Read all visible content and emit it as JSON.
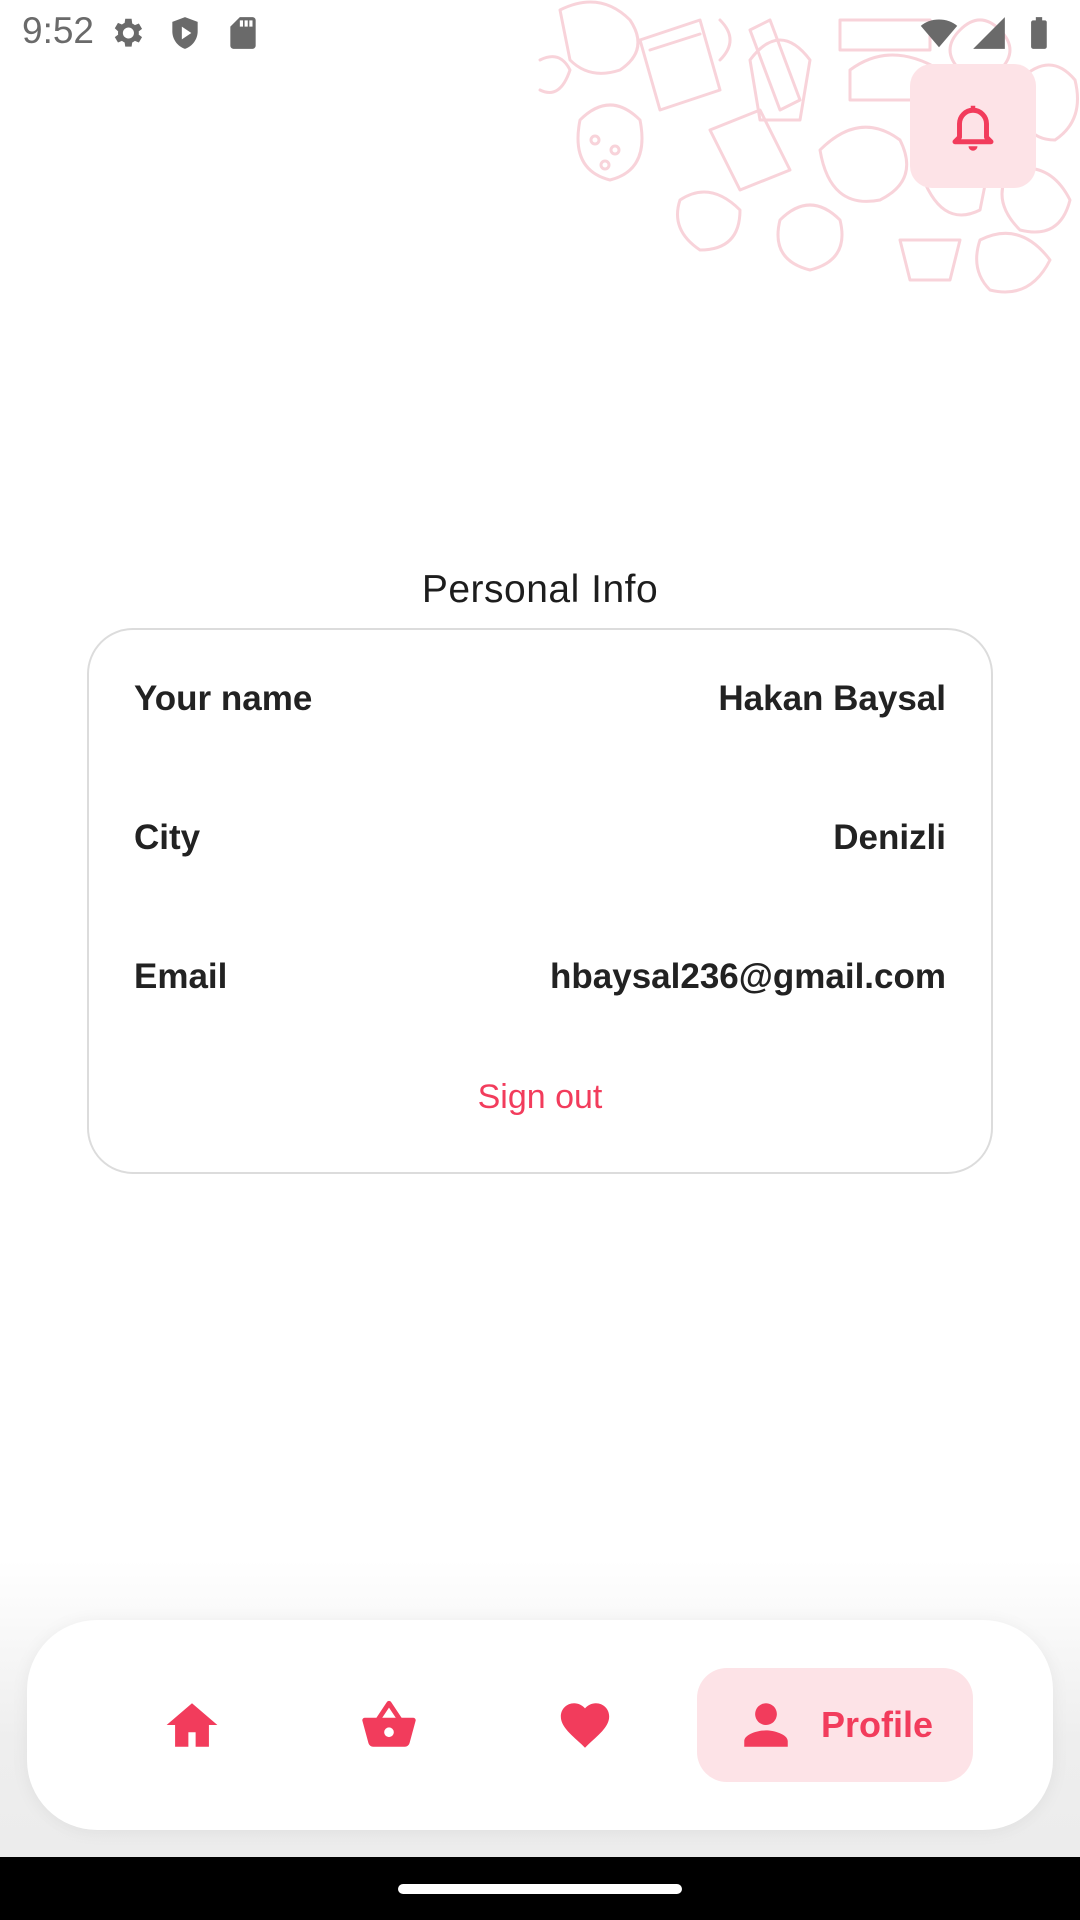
{
  "status_bar": {
    "time": "9:52",
    "left_icons": [
      "gear-icon",
      "shield-play-icon",
      "sd-card-icon"
    ],
    "right_icons": [
      "wifi-icon",
      "signal-icon",
      "battery-icon"
    ]
  },
  "header": {
    "notification_icon": "bell-icon"
  },
  "personal_info": {
    "title": "Personal Info",
    "rows": [
      {
        "label": "Your name",
        "value": "Hakan Baysal"
      },
      {
        "label": "City",
        "value": "Denizli"
      },
      {
        "label": "Email",
        "value": "hbaysal236@gmail.com"
      }
    ],
    "sign_out": "Sign out"
  },
  "bottom_nav": {
    "items": [
      {
        "icon": "home-icon",
        "label": ""
      },
      {
        "icon": "basket-icon",
        "label": ""
      },
      {
        "icon": "heart-icon",
        "label": ""
      },
      {
        "icon": "person-icon",
        "label": "Profile",
        "active": true
      }
    ]
  },
  "colors": {
    "accent": "#f23c5c",
    "accent_light": "#fde3e7",
    "card_border": "#dcdcdc"
  }
}
